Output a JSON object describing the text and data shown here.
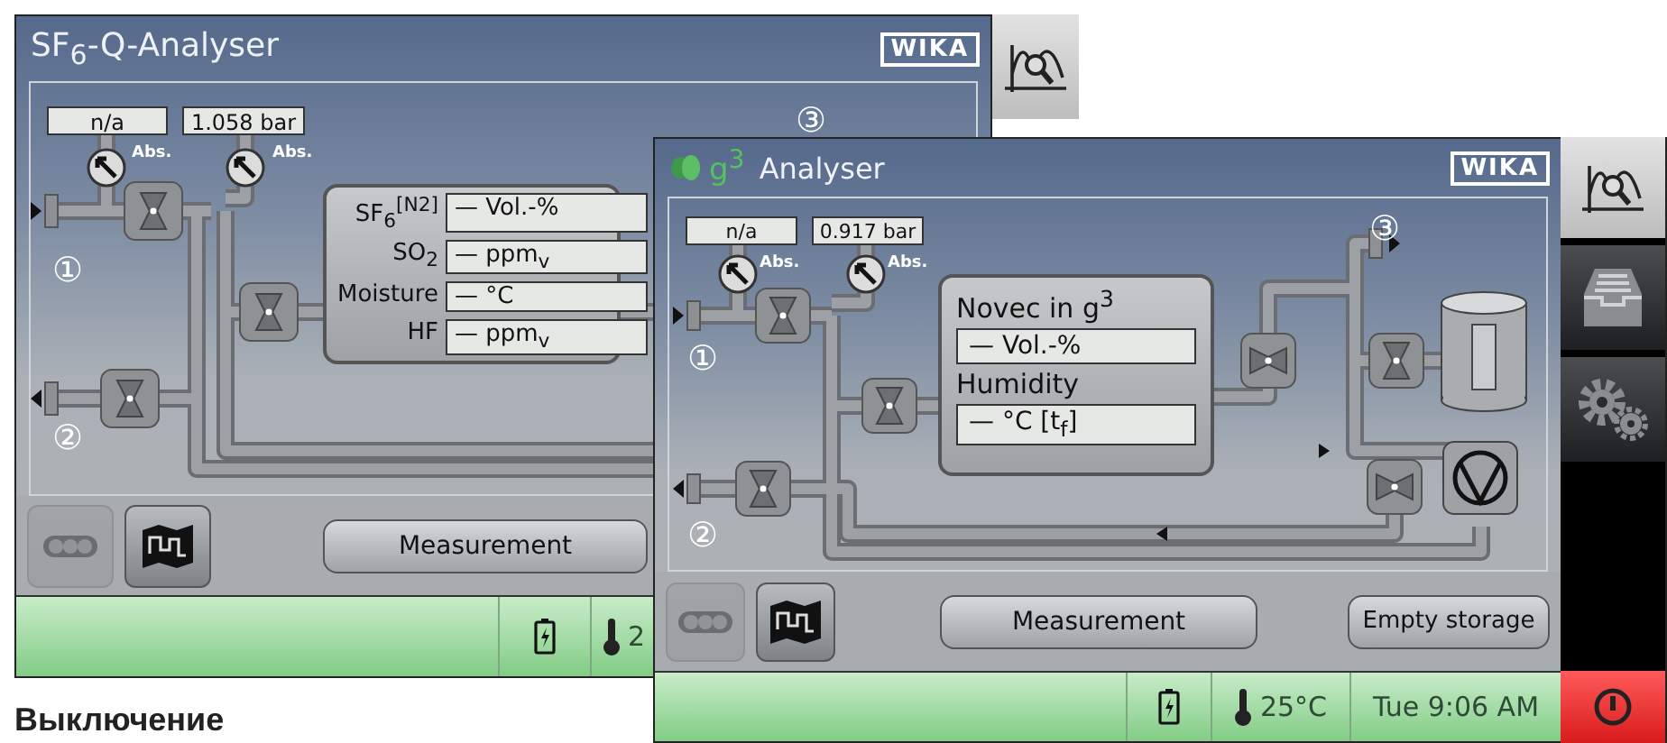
{
  "back_screen": {
    "title": "SF$_{6}$-Q-Analyser",
    "brand": "WIKA",
    "gauges": [
      {
        "value": "n/a",
        "label": "Abs."
      },
      {
        "value": "1.058 bar",
        "label": "Abs."
      }
    ],
    "ports": [
      "①",
      "②",
      "③"
    ],
    "readings": [
      {
        "label": "SF$_{6}$$^{[N2]}$",
        "value": "— Vol.-%"
      },
      {
        "label": "SO$_{2}$",
        "value": "— ppm$_{v}$"
      },
      {
        "label": "Moisture",
        "value": "— °C"
      },
      {
        "label": "HF",
        "value": "— ppm$_{v}$"
      }
    ],
    "view_buttons": [
      {
        "kind": "piping",
        "selected": true
      },
      {
        "kind": "map",
        "selected": false
      }
    ],
    "action_buttons": [
      "Measurement"
    ],
    "status": {
      "temperature": "2"
    }
  },
  "front_screen": {
    "logo_text": "g$^{3}$",
    "title": "Analyser",
    "brand": "WIKA",
    "gauges": [
      {
        "value": "n/a",
        "label": "Abs."
      },
      {
        "value": "0.917 bar",
        "label": "Abs."
      }
    ],
    "ports": [
      "①",
      "②",
      "③"
    ],
    "readings": [
      {
        "label": "Novec in g$^{3}$",
        "value": "— Vol.-%"
      },
      {
        "label": "Humidity",
        "value": "— °C [t$_{f}$]"
      }
    ],
    "view_buttons": [
      {
        "kind": "piping",
        "selected": true
      },
      {
        "kind": "map",
        "selected": false
      }
    ],
    "action_buttons": [
      "Measurement",
      "Empty storage"
    ],
    "status": {
      "temperature": "25°C",
      "clock": "Tue 9:06 AM"
    }
  },
  "caption": "Выключение"
}
